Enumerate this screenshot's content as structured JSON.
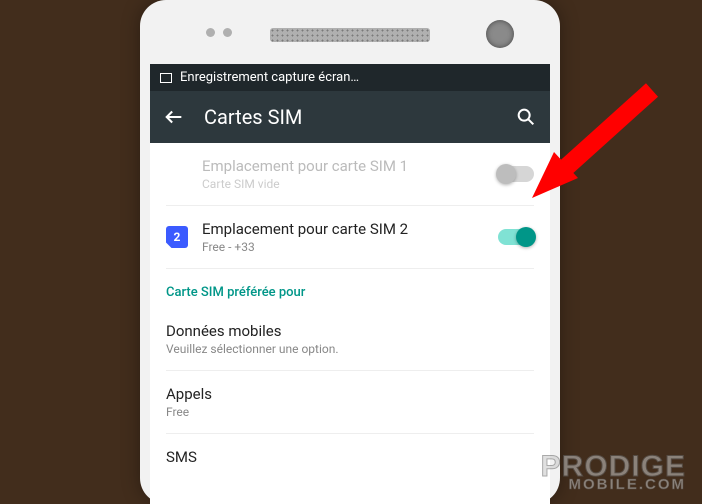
{
  "notification": {
    "text": "Enregistrement capture écran…"
  },
  "header": {
    "title": "Cartes SIM"
  },
  "simSlots": [
    {
      "label": "Emplacement pour carte SIM 1",
      "sub": "Carte SIM vide",
      "badge": "",
      "enabled": false,
      "switch": false
    },
    {
      "label": "Emplacement pour carte SIM 2",
      "sub": "Free - +33",
      "badge": "2",
      "enabled": true,
      "switch": true
    }
  ],
  "preferredSection": {
    "title": "Carte SIM préférée pour",
    "items": [
      {
        "label": "Données mobiles",
        "sub": "Veuillez sélectionner une option."
      },
      {
        "label": "Appels",
        "sub": "Free"
      },
      {
        "label": "SMS",
        "sub": ""
      }
    ]
  },
  "watermark": {
    "line1": "PRODIGE",
    "line2": "MOBILE.COM"
  },
  "colors": {
    "accent": "#009688",
    "headerBg": "#2d383d"
  }
}
